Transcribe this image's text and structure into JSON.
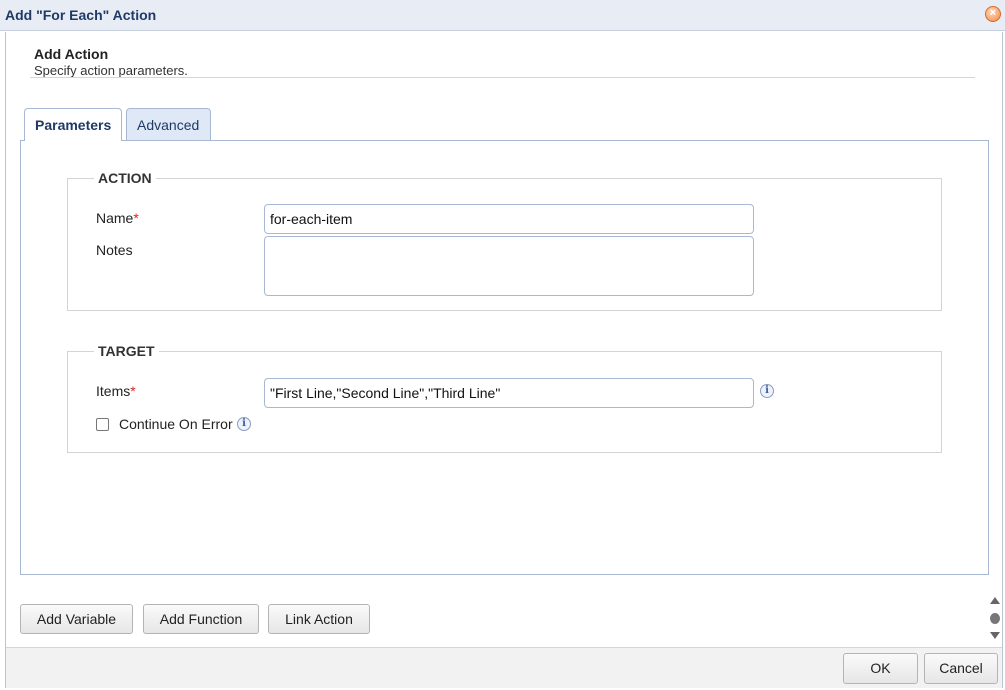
{
  "window": {
    "title": "Add \"For Each\" Action"
  },
  "header": {
    "title": "Add Action",
    "subtitle": "Specify action parameters."
  },
  "tabs": [
    {
      "label": "Parameters",
      "active": true
    },
    {
      "label": "Advanced",
      "active": false
    }
  ],
  "action_group": {
    "legend": "ACTION",
    "name_label": "Name",
    "name_value": "for-each-item",
    "notes_label": "Notes",
    "notes_value": ""
  },
  "target_group": {
    "legend": "TARGET",
    "items_label": "Items",
    "items_value": "\"First Line,\"Second Line\",\"Third Line\"",
    "continue_on_error_label": "Continue On Error",
    "continue_on_error_checked": false
  },
  "required_marker": "*",
  "info_glyph": "i",
  "buttons": {
    "add_variable": "Add Variable",
    "add_function": "Add Function",
    "link_action": "Link Action",
    "ok": "OK",
    "cancel": "Cancel"
  },
  "icons": {
    "close": "close-icon",
    "info": "info-icon"
  }
}
